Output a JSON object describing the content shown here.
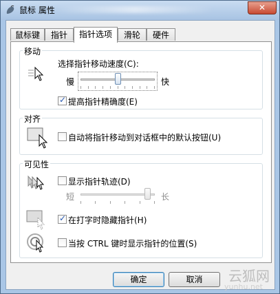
{
  "window": {
    "title": "鼠标 属性",
    "close_glyph": "✕"
  },
  "tabs": [
    {
      "label": "鼠标键"
    },
    {
      "label": "指针"
    },
    {
      "label": "指针选项"
    },
    {
      "label": "滑轮"
    },
    {
      "label": "硬件"
    }
  ],
  "active_tab": "指针选项",
  "motion": {
    "group_label": "移动",
    "speed_label": "选择指针移动速度(C):",
    "slow_label": "慢",
    "fast_label": "快",
    "speed_value_fraction": 0.5,
    "precision_label": "提高指针精确度(E)",
    "precision_checked": true
  },
  "snap_to": {
    "group_label": "对齐",
    "label": "自动将指针移动到对话框中的默认按钮(U)",
    "checked": false
  },
  "visibility": {
    "group_label": "可见性",
    "trails_label": "显示指针轨迹(D)",
    "trails_checked": false,
    "short_label": "短",
    "long_label": "长",
    "trails_value_fraction": 0.9,
    "hide_typing_label": "在打字时隐藏指针(H)",
    "hide_typing_checked": true,
    "ctrl_label": "当按 CTRL 键时显示指针的位置(S)",
    "ctrl_checked": false
  },
  "buttons": {
    "ok_label": "确定",
    "cancel_label": "取消"
  },
  "watermark": {
    "text": "云狐网",
    "sub": "yunhu.net"
  },
  "colors": {
    "window_frame": "#a9c6e6",
    "close_button": "#c74a33",
    "check_mark": "#2a5bb5"
  }
}
